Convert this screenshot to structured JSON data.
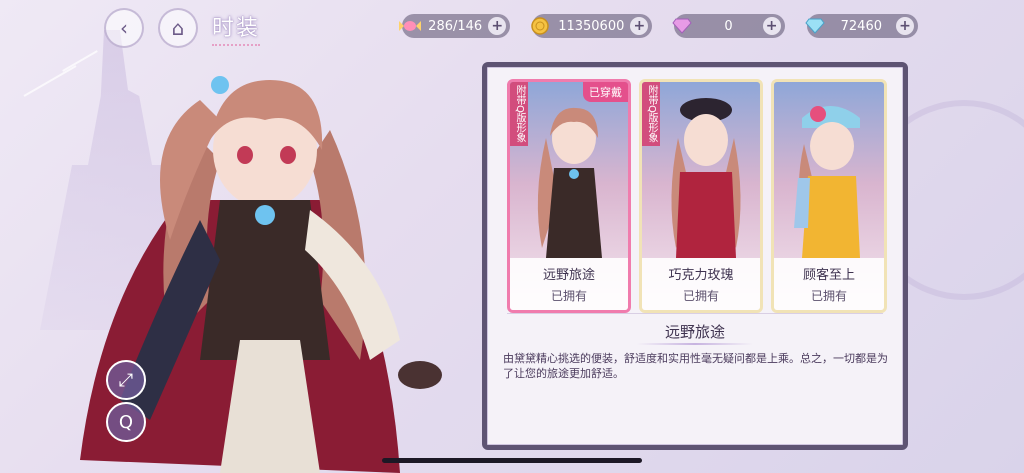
{
  "header": {
    "back_icon": "back-arrow-icon",
    "home_icon": "castle-home-icon",
    "title": "时装"
  },
  "resources": [
    {
      "icon": "candy-icon",
      "value": "286/146"
    },
    {
      "icon": "gold-coin-icon",
      "value": "11350600"
    },
    {
      "icon": "pink-diamond-icon",
      "value": "0"
    },
    {
      "icon": "blue-diamond-icon",
      "value": "72460"
    }
  ],
  "outfits": [
    {
      "ribbon": "附带Q版形象",
      "badge": "已穿戴",
      "name": "远野旅途",
      "status": "已拥有",
      "selected": true
    },
    {
      "ribbon": "附带Q版形象",
      "badge": "",
      "name": "巧克力玫瑰",
      "status": "已拥有",
      "selected": false
    },
    {
      "ribbon": "",
      "badge": "",
      "name": "顾客至上",
      "status": "已拥有",
      "selected": false
    }
  ],
  "detail": {
    "title": "远野旅途",
    "description": "由黛黛精心挑选的便装，舒适度和实用性毫无疑问都是上乘。总之，一切都是为了让您的旅途更加舒适。"
  },
  "colors": {
    "accent_pink": "#e4508c",
    "panel_border": "#5e5473",
    "background": "#e6ddef"
  }
}
